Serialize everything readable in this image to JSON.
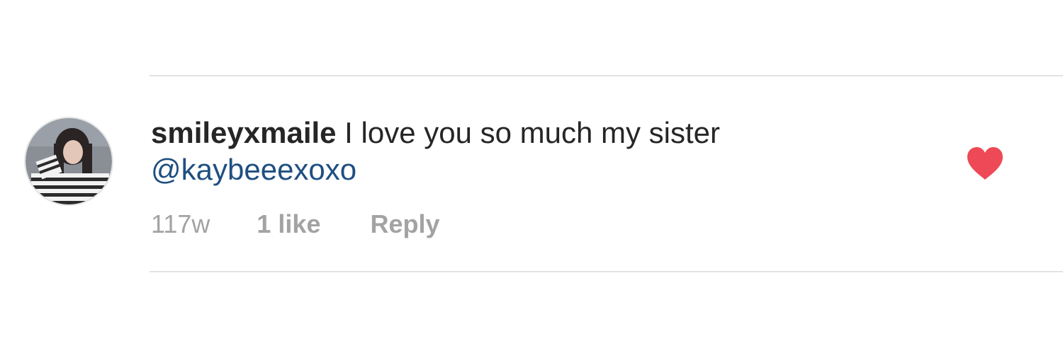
{
  "comment": {
    "username": "smileyxmaile",
    "text": " I love you so much my sister ",
    "mention": "@kaybeeexoxo",
    "time": "117w",
    "likes": "1 like",
    "reply_label": "Reply",
    "liked": true
  },
  "colors": {
    "heart": "#ed4956",
    "mention": "#1f4f80",
    "meta": "#a3a3a3",
    "text": "#262626",
    "divider": "#e3e3e3"
  },
  "icons": {
    "like": "heart-icon"
  }
}
